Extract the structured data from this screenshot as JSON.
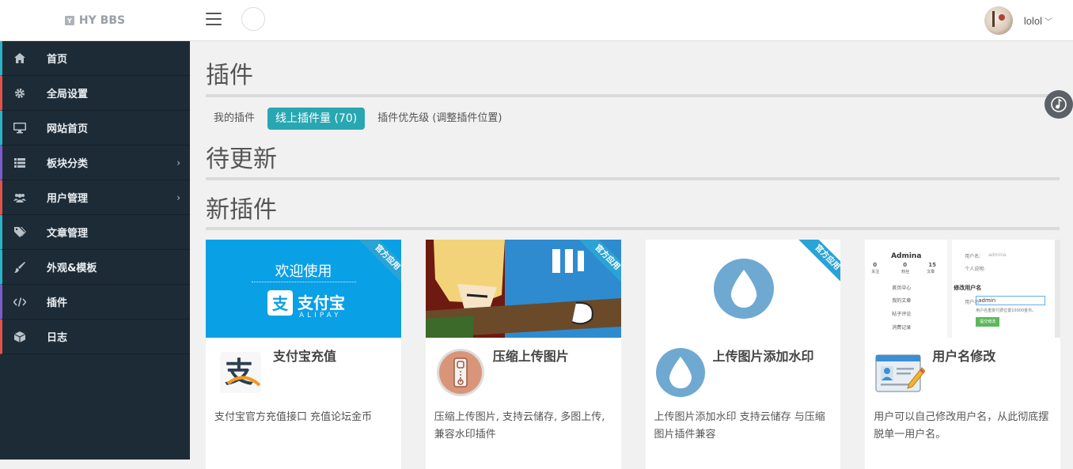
{
  "brand": {
    "text": "HY BBS",
    "mark": "Y"
  },
  "user": {
    "name": "lolol",
    "caret": "﹀"
  },
  "sidebar": {
    "items": [
      {
        "label": "首页",
        "icon": "home-icon",
        "accent": "#2ab2c7",
        "arrow": ""
      },
      {
        "label": "全局设置",
        "icon": "gear-icon",
        "accent": "#e0544b",
        "arrow": ""
      },
      {
        "label": "网站首页",
        "icon": "monitor-icon",
        "accent": "#2ab2c7",
        "arrow": ""
      },
      {
        "label": "板块分类",
        "icon": "list-icon",
        "accent": "#7a5ccc",
        "arrow": "›"
      },
      {
        "label": "用户管理",
        "icon": "users-icon",
        "accent": "#e0544b",
        "arrow": "›"
      },
      {
        "label": "文章管理",
        "icon": "tags-icon",
        "accent": "#2ab2c7",
        "arrow": ""
      },
      {
        "label": "外观&模板",
        "icon": "brush-icon",
        "accent": "#2ab2c7",
        "arrow": ""
      },
      {
        "label": "插件",
        "icon": "code-icon",
        "accent": "#7a5ccc",
        "arrow": ""
      },
      {
        "label": "日志",
        "icon": "cube-icon",
        "accent": "#e0544b",
        "arrow": ""
      }
    ]
  },
  "main": {
    "title": "插件",
    "tabs": [
      {
        "label": "我的插件",
        "active": false
      },
      {
        "label": "线上插件量 (70)",
        "active": true
      },
      {
        "label": "插件优先级 (调整插件位置)",
        "active": false
      }
    ],
    "pending_title": "待更新",
    "new_title": "新插件",
    "ribbon_label": "官方应用",
    "cards": [
      {
        "title": "支付宝充值",
        "desc": "支付宝官方充值接口 充值论坛金币",
        "banner_text_1": "欢迎使用",
        "banner_text_2": "支付宝",
        "banner_text_3": "ALIPAY"
      },
      {
        "title": "压缩上传图片",
        "desc": "压缩上传图片, 支持云储存, 多图上传, 兼容水印插件"
      },
      {
        "title": "上传图片添加水印",
        "desc": "上传图片添加水印 支持云储存 与压缩图片插件兼容"
      },
      {
        "title": "用户名修改",
        "desc": "用户可以自己修改用户名，从此彻底摆脱单一用户名。",
        "shot": {
          "name": "Admina",
          "stats": [
            "0",
            "0",
            "15"
          ],
          "stat_labels": [
            "关注",
            "粉丝",
            "文章"
          ],
          "menu": [
            "首页中心",
            "我的文章",
            "帖子评论",
            "消费记录"
          ],
          "field_label": "用户名:",
          "field_value": "admina",
          "hint": "个人说明:",
          "form_title": "修改用户名",
          "input_label": "用户名",
          "input_value": "admin",
          "note": "用户名重复付费位置10000金币。",
          "btn": "提交修改"
        }
      }
    ]
  }
}
